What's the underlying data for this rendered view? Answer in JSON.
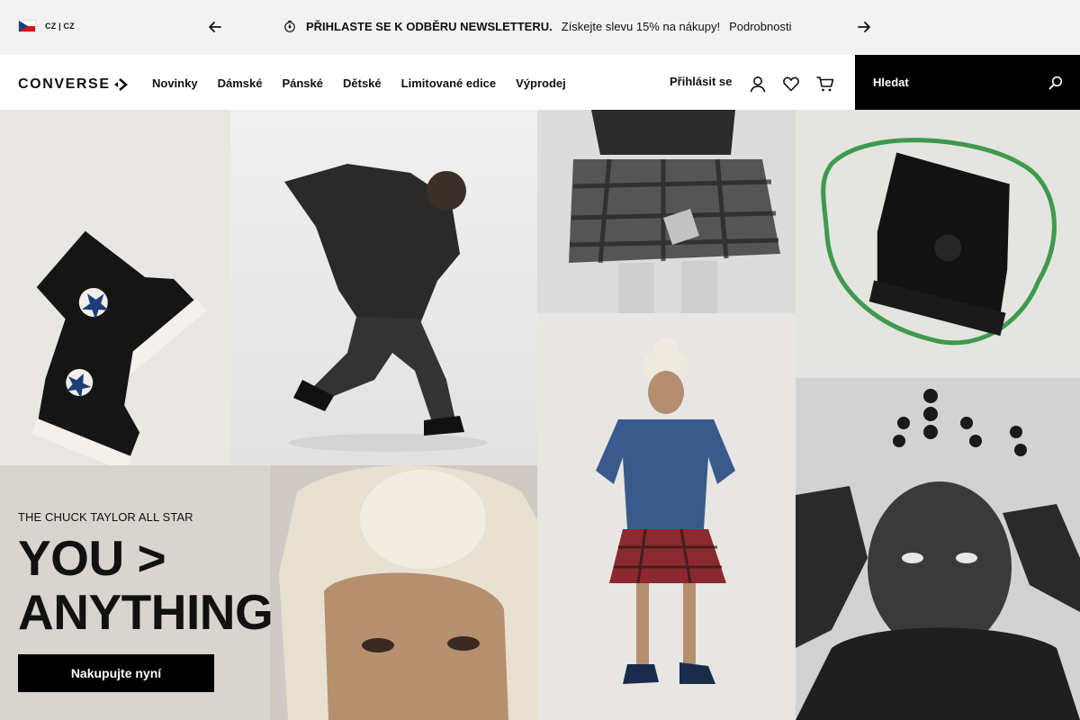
{
  "promo": {
    "locale": "CZ | CZ",
    "headline": "PŘIHLASTE SE K ODBĚRU NEWSLETTERU.",
    "message": "Získejte slevu 15% na nákupy!",
    "link": "Podrobnosti"
  },
  "header": {
    "logo_text": "CONVERSE",
    "nav": [
      {
        "label": "Novinky"
      },
      {
        "label": "Dámské"
      },
      {
        "label": "Pánské"
      },
      {
        "label": "Dětské"
      },
      {
        "label": "Limitované edice"
      },
      {
        "label": "Výprodej"
      }
    ],
    "signin": "Přihlásit se",
    "search_label": "Hledat"
  },
  "hero": {
    "eyebrow": "THE CHUCK TAYLOR ALL STAR",
    "title_line1": "YOU >",
    "title_line2": "ANYTHING",
    "cta": "Nakupujte nyní"
  },
  "icons": {
    "prev": "arrow-left-icon",
    "next": "arrow-right-icon",
    "promo": "timer-icon",
    "user": "user-icon",
    "heart": "heart-icon",
    "cart": "cart-icon",
    "search": "search-icon"
  },
  "colors": {
    "promo_bg": "#f2f2f2",
    "search_bg": "#000000",
    "cta_bg": "#000000",
    "flag_red": "#d7141a",
    "flag_blue": "#11457e"
  }
}
